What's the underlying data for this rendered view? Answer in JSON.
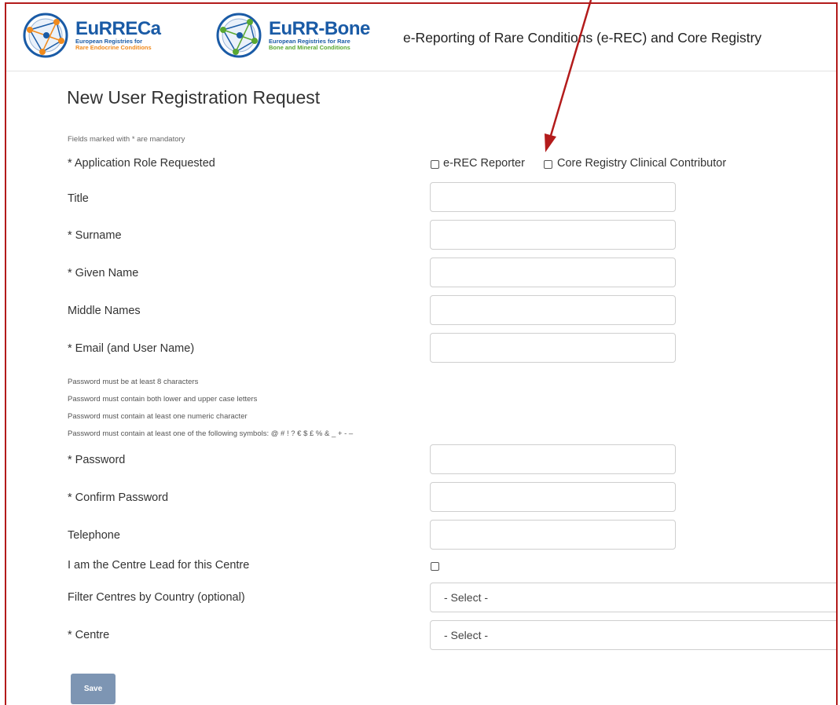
{
  "header": {
    "logo1": {
      "name": "EuRRECa",
      "sub1": "European Registries for",
      "sub2": "Rare Endocrine Conditions"
    },
    "logo2": {
      "name": "EuRR-Bone",
      "sub1": "European Registries for Rare",
      "sub2": "Bone and Mineral Conditions"
    },
    "app_title": "e-Reporting of Rare Conditions (e-REC) and Core Registry"
  },
  "form": {
    "title": "New User Registration Request",
    "mandatory_note": "Fields marked with * are mandatory",
    "application_role": {
      "label": "* Application Role Requested",
      "options": [
        "e-REC Reporter",
        "Core Registry Clinical Contributor"
      ]
    },
    "fields": {
      "title": {
        "label": "Title",
        "value": ""
      },
      "surname": {
        "label": "* Surname",
        "value": ""
      },
      "given_name": {
        "label": "* Given Name",
        "value": ""
      },
      "middle_names": {
        "label": "Middle Names",
        "value": ""
      },
      "email": {
        "label": "* Email (and User Name)",
        "value": ""
      },
      "password": {
        "label": "* Password",
        "value": ""
      },
      "confirm_password": {
        "label": "* Confirm Password",
        "value": ""
      },
      "telephone": {
        "label": "Telephone",
        "value": ""
      }
    },
    "password_rules": [
      "Password must be at least 8 characters",
      "Password must contain both lower and upper case letters",
      "Password must contain at least one numeric character",
      "Password must contain at least one of the following symbols: @ # ! ? € $ £ % & _ + - –"
    ],
    "centre_lead": {
      "label": "I am the Centre Lead for this Centre",
      "checked": false
    },
    "country_filter": {
      "label": "Filter Centres by Country (optional)",
      "selected": "- Select -"
    },
    "centre": {
      "label": "* Centre",
      "selected": "- Select -"
    },
    "save_label": "Save"
  },
  "colors": {
    "frame_border": "#b31b1b",
    "annotation_arrow": "#b31b1b",
    "save_button": "#7d95b3",
    "logo_blue": "#1a5ba6",
    "logo_orange": "#f08a1c",
    "logo_green": "#5aa832"
  }
}
